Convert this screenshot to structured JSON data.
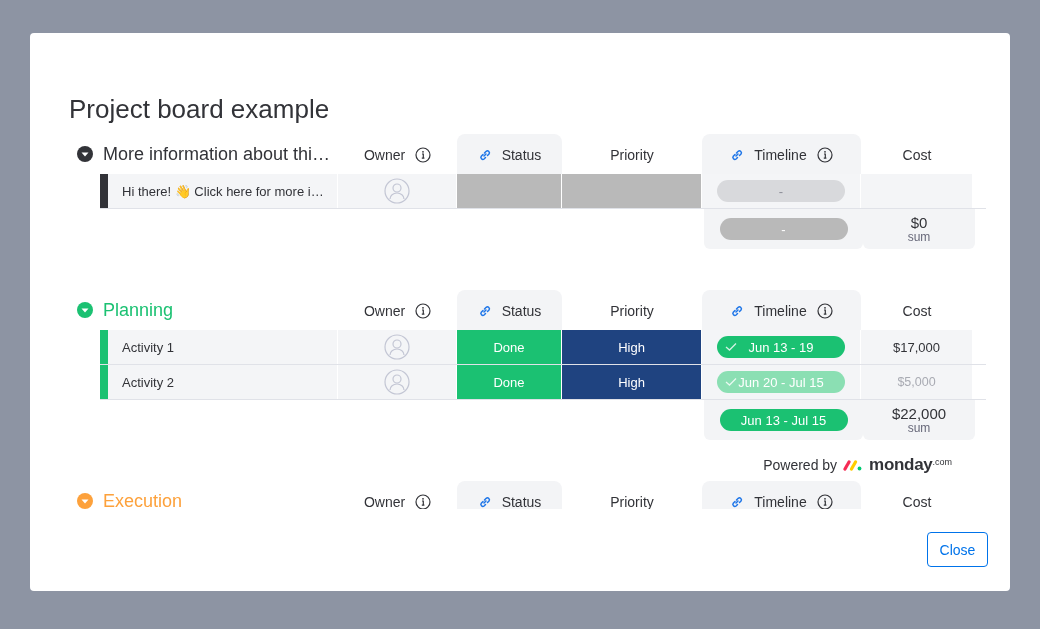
{
  "dialog": {
    "title": "Project board example",
    "close_button": "Close"
  },
  "groups": [
    {
      "title": "More information about thi…",
      "color": "#323338",
      "expanded": true,
      "columns": [
        {
          "label": "Owner",
          "link": false,
          "info": true,
          "shaded": false
        },
        {
          "label": "Status",
          "link": true,
          "info": false,
          "shaded": true
        },
        {
          "label": "Priority",
          "link": false,
          "info": false,
          "shaded": false
        },
        {
          "label": "Timeline",
          "link": true,
          "info": true,
          "shaded": true
        },
        {
          "label": "Cost",
          "link": false,
          "info": false,
          "shaded": false
        }
      ],
      "rows": [
        {
          "name": "Hi there! 👋 Click here for more i…",
          "status": {
            "color": "#b9b9b9"
          },
          "priority": {
            "color": "#b9b9b9"
          },
          "timeline": {
            "label": "-",
            "color": "#d8d9dc",
            "check": false,
            "empty": true
          }
        }
      ],
      "summary": {
        "timeline": {
          "label": "-",
          "color": "#b9b9b9"
        },
        "cost": "$0",
        "cost_caption": "sum"
      }
    },
    {
      "title": "Planning",
      "color": "#1bc172",
      "expanded": true,
      "columns": [
        {
          "label": "Owner",
          "link": false,
          "info": true,
          "shaded": false
        },
        {
          "label": "Status",
          "link": true,
          "info": false,
          "shaded": true
        },
        {
          "label": "Priority",
          "link": false,
          "info": false,
          "shaded": false
        },
        {
          "label": "Timeline",
          "link": true,
          "info": true,
          "shaded": true
        },
        {
          "label": "Cost",
          "link": false,
          "info": false,
          "shaded": false
        }
      ],
      "rows": [
        {
          "name": "Activity 1",
          "status": {
            "label": "Done",
            "color": "#1bc172"
          },
          "priority": {
            "label": "High",
            "color": "#1f4380"
          },
          "timeline": {
            "label": "Jun 13 - 19",
            "color": "#1bc172",
            "check": true,
            "empty": false
          },
          "cost": "$17,000",
          "dimmed": false
        },
        {
          "name": "Activity 2",
          "status": {
            "label": "Done",
            "color": "#1bc172"
          },
          "priority": {
            "label": "High",
            "color": "#1f4380"
          },
          "timeline": {
            "label": "Jun 20 - Jul 15",
            "color": "#8bdfb3",
            "check": true,
            "empty": false
          },
          "cost": "$5,000",
          "dimmed": true
        }
      ],
      "summary": {
        "timeline": {
          "label": "Jun 13 - Jul 15",
          "color": "#1bc172"
        },
        "cost": "$22,000",
        "cost_caption": "sum"
      }
    },
    {
      "title": "Execution",
      "color": "#fda13b",
      "expanded": true,
      "columns": [
        {
          "label": "Owner",
          "link": false,
          "info": true,
          "shaded": false
        },
        {
          "label": "Status",
          "link": true,
          "info": false,
          "shaded": true
        },
        {
          "label": "Priority",
          "link": false,
          "info": false,
          "shaded": false
        },
        {
          "label": "Timeline",
          "link": true,
          "info": true,
          "shaded": true
        },
        {
          "label": "Cost",
          "link": false,
          "info": false,
          "shaded": false
        }
      ]
    }
  ],
  "powered_by": {
    "label": "Powered by",
    "brand": "monday",
    "suffix": ".com"
  }
}
